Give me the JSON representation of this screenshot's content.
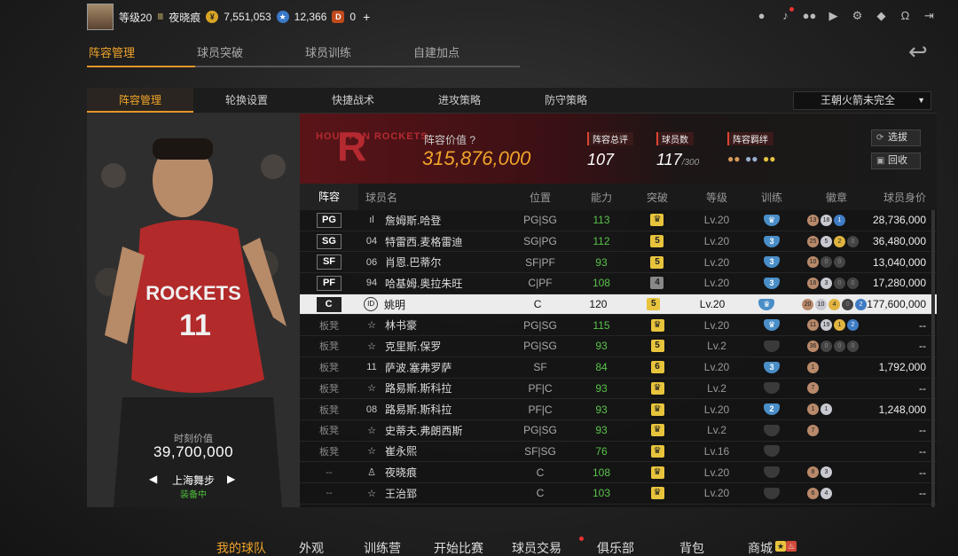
{
  "header": {
    "level": "等级20",
    "vip": "Ⅲ",
    "username": "夜晓痕",
    "gold": "7,551,053",
    "points": "12,366",
    "diamonds": "0",
    "plus": "+"
  },
  "icons": {
    "coin": "¥",
    "star": "★",
    "diamond": "D",
    "user": "person-icon",
    "bell": "bell-icon",
    "friends": "friends-icon",
    "video": "video-icon",
    "settings": "gear-icon",
    "shield": "shield-icon",
    "support": "headset-icon",
    "exit": "exit-icon",
    "back": "back-arrow-icon"
  },
  "main_tabs": [
    "阵容管理",
    "球员突破",
    "球员训练",
    "自建加点"
  ],
  "sub_tabs": [
    "阵容管理",
    "轮换设置",
    "快捷战术",
    "进攻策略",
    "防守策略"
  ],
  "team_select": "王朝火箭未完全",
  "team": {
    "logo_text": "HOUSTON ROCKETS",
    "value_label": "阵容价值",
    "value": "315,876,000",
    "rating_label": "阵容总评",
    "rating": "107",
    "count_label": "球员数",
    "count": "117",
    "count_max": "/300",
    "chem_label": "阵容羁绊",
    "btn_filter": "选拔",
    "btn_recycle": "回收"
  },
  "player_art": {
    "moment_label": "时刻价值",
    "moment_value": "39,700,000",
    "skin": "上海舞步",
    "status": "装备中"
  },
  "columns": [
    "阵容",
    "球员名",
    "位置",
    "能力",
    "突破",
    "等级",
    "训练",
    "徽章",
    "球员身价"
  ],
  "rows": [
    {
      "pos": "PG",
      "num": "ıl",
      "name": "詹姆斯.哈登",
      "slot": "PG|SG",
      "ovr": "113",
      "brk": "♛",
      "lv": "Lv.20",
      "train": "♛",
      "price": "28,736,000"
    },
    {
      "pos": "SG",
      "num": "04",
      "name": "特雷西.麦格雷迪",
      "slot": "SG|PG",
      "ovr": "112",
      "brk": "5",
      "lv": "Lv.20",
      "train": "3",
      "price": "36,480,000"
    },
    {
      "pos": "SF",
      "num": "06",
      "name": "肖恩.巴蒂尔",
      "slot": "SF|PF",
      "ovr": "93",
      "brk": "5",
      "lv": "Lv.20",
      "train": "3",
      "price": "13,040,000"
    },
    {
      "pos": "PF",
      "num": "94",
      "name": "哈基姆.奥拉朱旺",
      "slot": "C|PF",
      "ovr": "108",
      "brk": "4",
      "lv": "Lv.20",
      "train": "3",
      "price": "17,280,000"
    },
    {
      "pos": "C",
      "num": "ID",
      "name": "姚明",
      "slot": "C",
      "ovr": "120",
      "brk": "5",
      "lv": "Lv.20",
      "train": "♛",
      "price": "177,600,000"
    },
    {
      "pos": "板凳",
      "num": "☆",
      "name": "林书豪",
      "slot": "PG|SG",
      "ovr": "115",
      "brk": "♛",
      "lv": "Lv.20",
      "train": "♛",
      "price": "--"
    },
    {
      "pos": "板凳",
      "num": "☆",
      "name": "克里斯.保罗",
      "slot": "PG|SG",
      "ovr": "93",
      "brk": "5",
      "lv": "Lv.2",
      "train": "",
      "price": "--"
    },
    {
      "pos": "板凳",
      "num": "11",
      "name": "萨波.塞弗罗萨",
      "slot": "SF",
      "ovr": "84",
      "brk": "6",
      "lv": "Lv.20",
      "train": "3",
      "price": "1,792,000"
    },
    {
      "pos": "板凳",
      "num": "☆",
      "name": "路易斯.斯科拉",
      "slot": "PF|C",
      "ovr": "93",
      "brk": "♛",
      "lv": "Lv.2",
      "train": "",
      "price": "--"
    },
    {
      "pos": "板凳",
      "num": "08",
      "name": "路易斯.斯科拉",
      "slot": "PF|C",
      "ovr": "93",
      "brk": "♛",
      "lv": "Lv.20",
      "train": "2",
      "price": "1,248,000"
    },
    {
      "pos": "板凳",
      "num": "☆",
      "name": "史蒂夫.弗朗西斯",
      "slot": "PG|SG",
      "ovr": "93",
      "brk": "♛",
      "lv": "Lv.2",
      "train": "",
      "price": "--"
    },
    {
      "pos": "板凳",
      "num": "☆",
      "name": "崔永熙",
      "slot": "SF|SG",
      "ovr": "76",
      "brk": "♛",
      "lv": "Lv.16",
      "train": "",
      "price": "--"
    },
    {
      "pos": "--",
      "num": "♙",
      "name": "夜晓痕",
      "slot": "C",
      "ovr": "108",
      "brk": "♛",
      "lv": "Lv.20",
      "train": "",
      "price": "--"
    },
    {
      "pos": "--",
      "num": "☆",
      "name": "王治郅",
      "slot": "C",
      "ovr": "103",
      "brk": "♛",
      "lv": "Lv.20",
      "train": "",
      "price": "--"
    }
  ],
  "badges": [
    [
      "13",
      "18",
      "1"
    ],
    [
      "25",
      "5",
      "2",
      "0"
    ],
    [
      "10",
      "0",
      "0"
    ],
    [
      "16",
      "3",
      "0",
      "0"
    ],
    [
      "20",
      "10",
      "4",
      "0",
      "2"
    ],
    [
      "11",
      "19",
      "1",
      "2"
    ],
    [
      "36",
      "0",
      "0",
      "0"
    ],
    [
      "1"
    ],
    [
      "7"
    ],
    [
      "1",
      "1"
    ],
    [
      "7"
    ],
    [],
    [
      "8",
      "3"
    ],
    [
      "6",
      "4"
    ]
  ],
  "bottom_nav": [
    "我的球队",
    "外观",
    "训练营",
    "开始比赛",
    "球员交易",
    "俱乐部",
    "背包",
    "商城"
  ]
}
